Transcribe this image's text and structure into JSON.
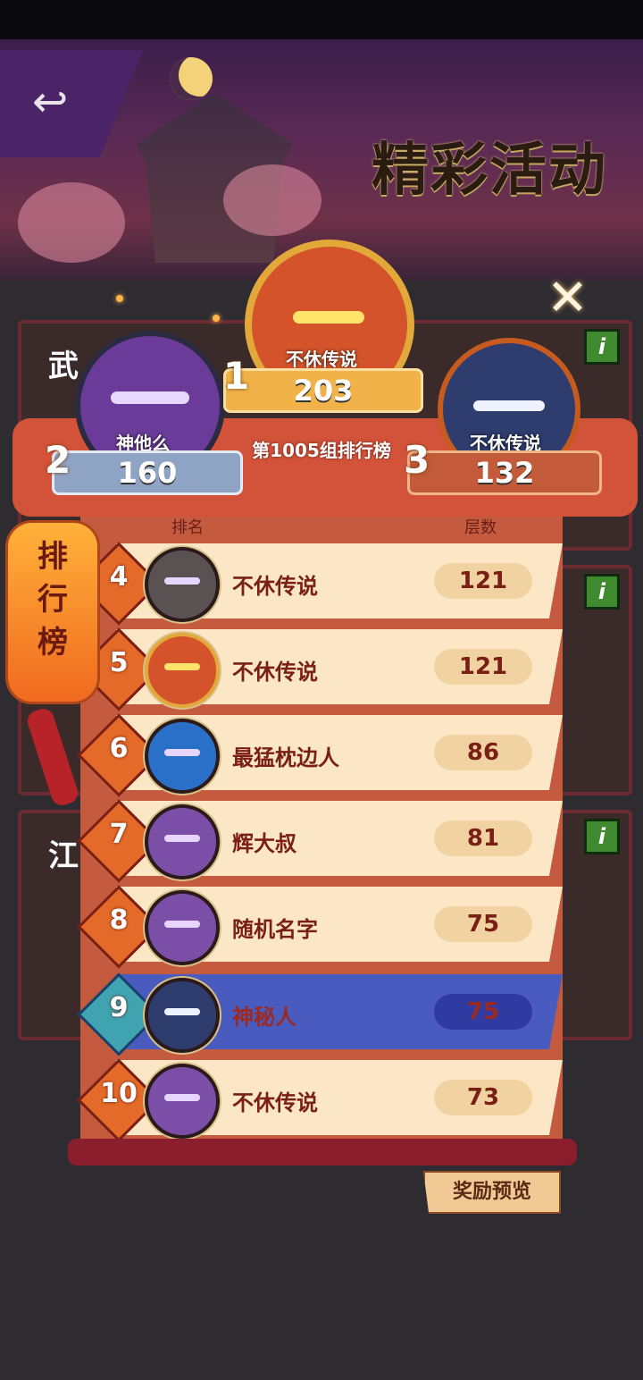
{
  "banner": {
    "title": "精彩活动"
  },
  "cards": [
    {
      "caption": "武",
      "info": "i"
    },
    {
      "caption": "",
      "info": "i"
    },
    {
      "caption": "江",
      "info": "i"
    }
  ],
  "lantern": {
    "label": "排行榜"
  },
  "leaderboard": {
    "group_title": "第1005组排行榜",
    "col_rank": "排名",
    "col_score": "层数",
    "podium": [
      {
        "rank": "1",
        "name": "不休传说",
        "score": "203",
        "color": "#f1b24a"
      },
      {
        "rank": "2",
        "name": "神他么",
        "score": "160",
        "color": "#8fa4c4"
      },
      {
        "rank": "3",
        "name": "不休传说",
        "score": "132",
        "color": "#c35a3a"
      }
    ],
    "rows": [
      {
        "rank": "4",
        "name": "不休传说",
        "score": "121",
        "avatar": "ninja-white-icon"
      },
      {
        "rank": "5",
        "name": "不休传说",
        "score": "121",
        "avatar": "fire-hero-icon"
      },
      {
        "rank": "6",
        "name": "最猛枕边人",
        "score": "86",
        "avatar": "blue-ninja-icon"
      },
      {
        "rank": "7",
        "name": "辉大叔",
        "score": "81",
        "avatar": "purple-ninja-icon"
      },
      {
        "rank": "8",
        "name": "随机名字",
        "score": "75",
        "avatar": "purple-ninja-icon"
      },
      {
        "rank": "9",
        "name": "神秘人",
        "score": "75",
        "avatar": "dark-knight-icon",
        "is_self": true
      },
      {
        "rank": "10",
        "name": "不休传说",
        "score": "73",
        "avatar": "purple-ninja-icon"
      }
    ]
  },
  "reward_button": "奖励预览",
  "close_icon": "close-icon"
}
